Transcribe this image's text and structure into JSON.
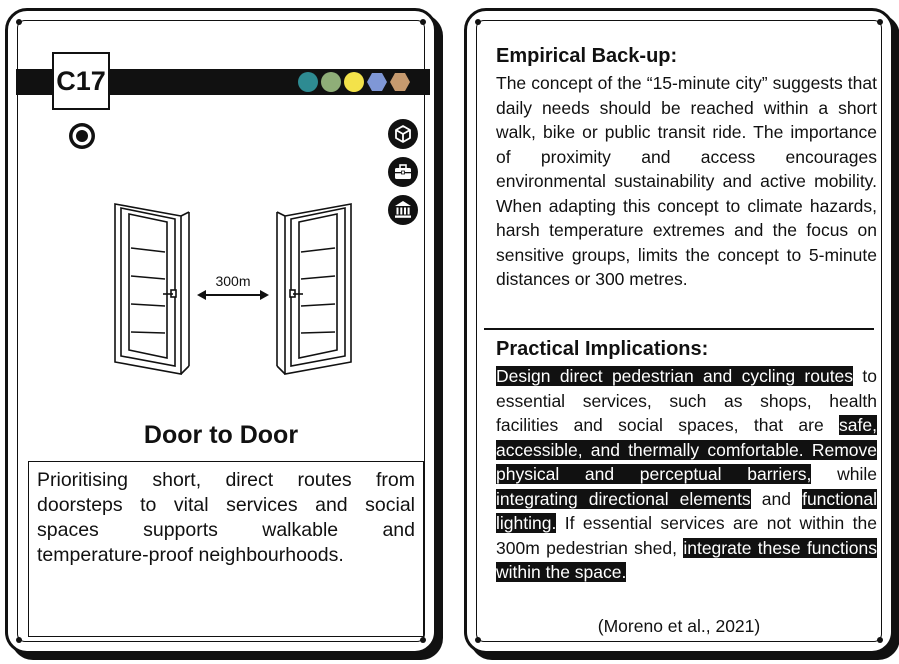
{
  "left_card": {
    "code": "C17",
    "swatch_colors": [
      "#2e8b92",
      "#8fae78",
      "#f3e24a",
      "#7f97d6",
      "#c69a6f"
    ],
    "distance_label": "300m",
    "title": "Door to Door",
    "description": "Prioritising short, direct routes from doorsteps to vital services and social spaces supports walkable and temperature-proof neighbourhoods.",
    "icons": [
      "target-icon",
      "cube-icon",
      "briefcase-icon",
      "bank-icon"
    ]
  },
  "right_card": {
    "empirical": {
      "heading": "Empirical Back-up:",
      "body": "The concept of the “15-minute city” suggests that daily needs should be reached within a short walk, bike or public transit ride. The importance of proximity and access encourages environmental sustainability and active mobility. When adapting this concept to climate hazards, harsh temperature extremes and the focus on sensitive groups, limits the concept to 5-minute distances or 300 metres."
    },
    "practical": {
      "heading": "Practical Implications:",
      "seg1": "Design direct pedestrian and cycling routes",
      "seg2": " to essential services, such as shops, health facilities and social spaces, that are ",
      "seg3": "safe, accessible, and thermally comfortable. Remove physical and perceptual barriers,",
      "seg4": " while ",
      "seg5": "integrating directional elements",
      "seg6": " and ",
      "seg7": "functional lighting.",
      "seg8": " If essential services are not within the 300m pedestrian shed, ",
      "seg9": "integrate these functions within the space."
    },
    "citation": "(Moreno et al., 2021)"
  }
}
